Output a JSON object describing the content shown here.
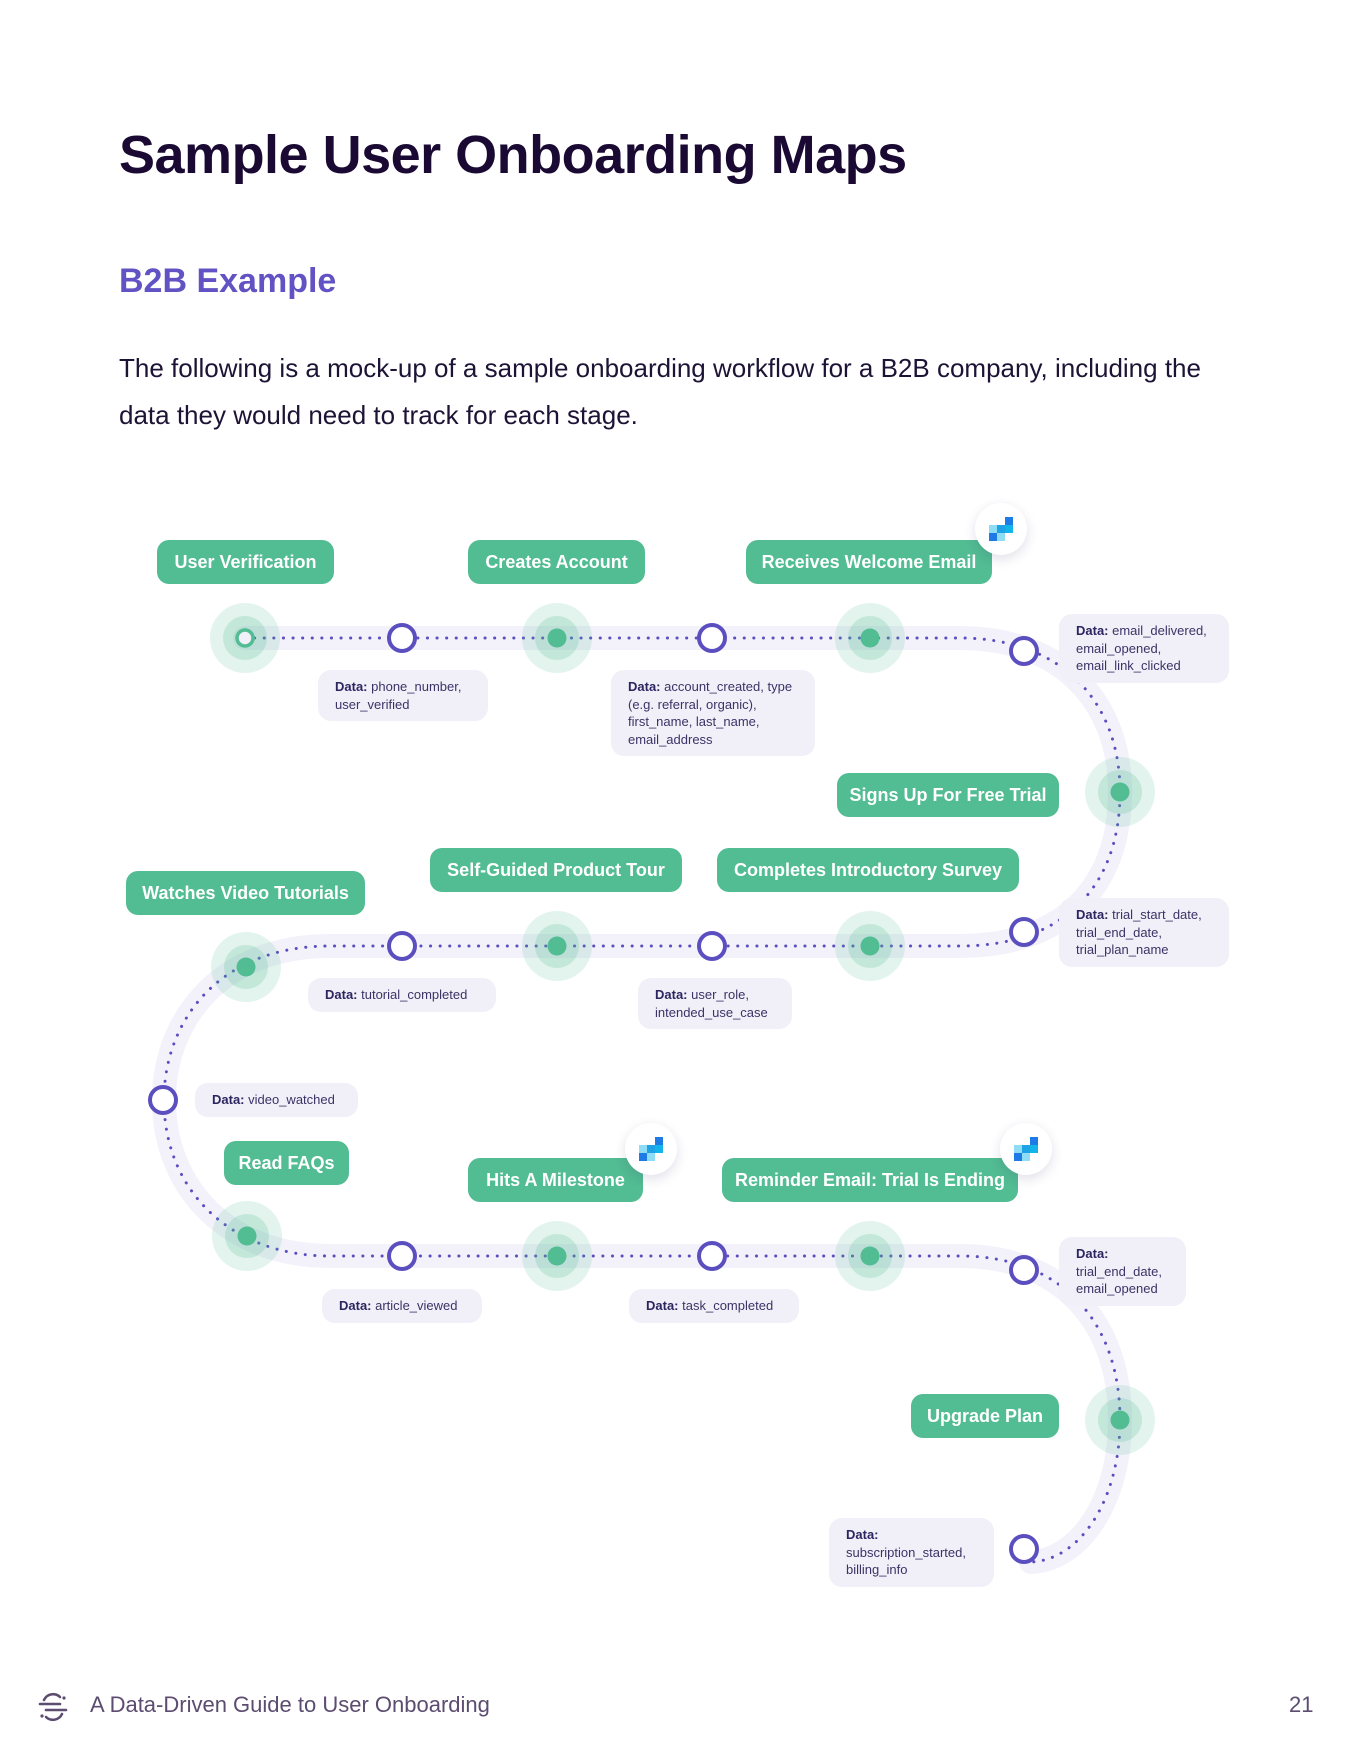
{
  "page": {
    "title": "Sample User Onboarding Maps",
    "subtitle": "B2B Example",
    "intro": "The following is a mock-up of a sample onboarding workflow for a B2B company, including the data they would need to track for each stage."
  },
  "colors": {
    "stage_pill": "#52bc93",
    "track": "#f3f2fa",
    "dots": "#5b4fc0",
    "data_box": "#f1f0f9",
    "heading_accent": "#6153c4"
  },
  "stages": [
    {
      "label": "User Verification",
      "segment_icon": false
    },
    {
      "label": "Creates Account",
      "segment_icon": false
    },
    {
      "label": "Receives Welcome Email",
      "segment_icon": true
    },
    {
      "label": "Signs Up For Free Trial",
      "segment_icon": false
    },
    {
      "label": "Completes Introductory Survey",
      "segment_icon": false
    },
    {
      "label": "Self-Guided Product Tour",
      "segment_icon": false
    },
    {
      "label": "Watches Video Tutorials",
      "segment_icon": false
    },
    {
      "label": "Read FAQs",
      "segment_icon": false
    },
    {
      "label": "Hits A Milestone",
      "segment_icon": true
    },
    {
      "label": "Reminder Email: Trial Is Ending",
      "segment_icon": true
    },
    {
      "label": "Upgrade Plan",
      "segment_icon": false
    }
  ],
  "data_points": [
    {
      "prefix": "Data:",
      "text": "phone_number, user_verified"
    },
    {
      "prefix": "Data:",
      "text": "account_created, type (e.g. referral, organic), first_name, last_name, email_address"
    },
    {
      "prefix": "Data:",
      "text": "email_delivered, email_opened, email_link_clicked"
    },
    {
      "prefix": "Data:",
      "text": "trial_start_date, trial_end_date, trial_plan_name"
    },
    {
      "prefix": "Data:",
      "text": "user_role, intended_use_case"
    },
    {
      "prefix": "Data:",
      "text": "tutorial_completed"
    },
    {
      "prefix": "Data:",
      "text": "video_watched"
    },
    {
      "prefix": "Data:",
      "text": "article_viewed"
    },
    {
      "prefix": "Data:",
      "text": "task_completed"
    },
    {
      "prefix": "Data:",
      "text": "trial_end_date, email_opened"
    },
    {
      "prefix": "Data:",
      "text": "subscription_started, billing_info"
    }
  ],
  "footer": {
    "icon": "segment-logo-icon",
    "text": "A Data-Driven Guide to User Onboarding",
    "page_number": "21"
  }
}
